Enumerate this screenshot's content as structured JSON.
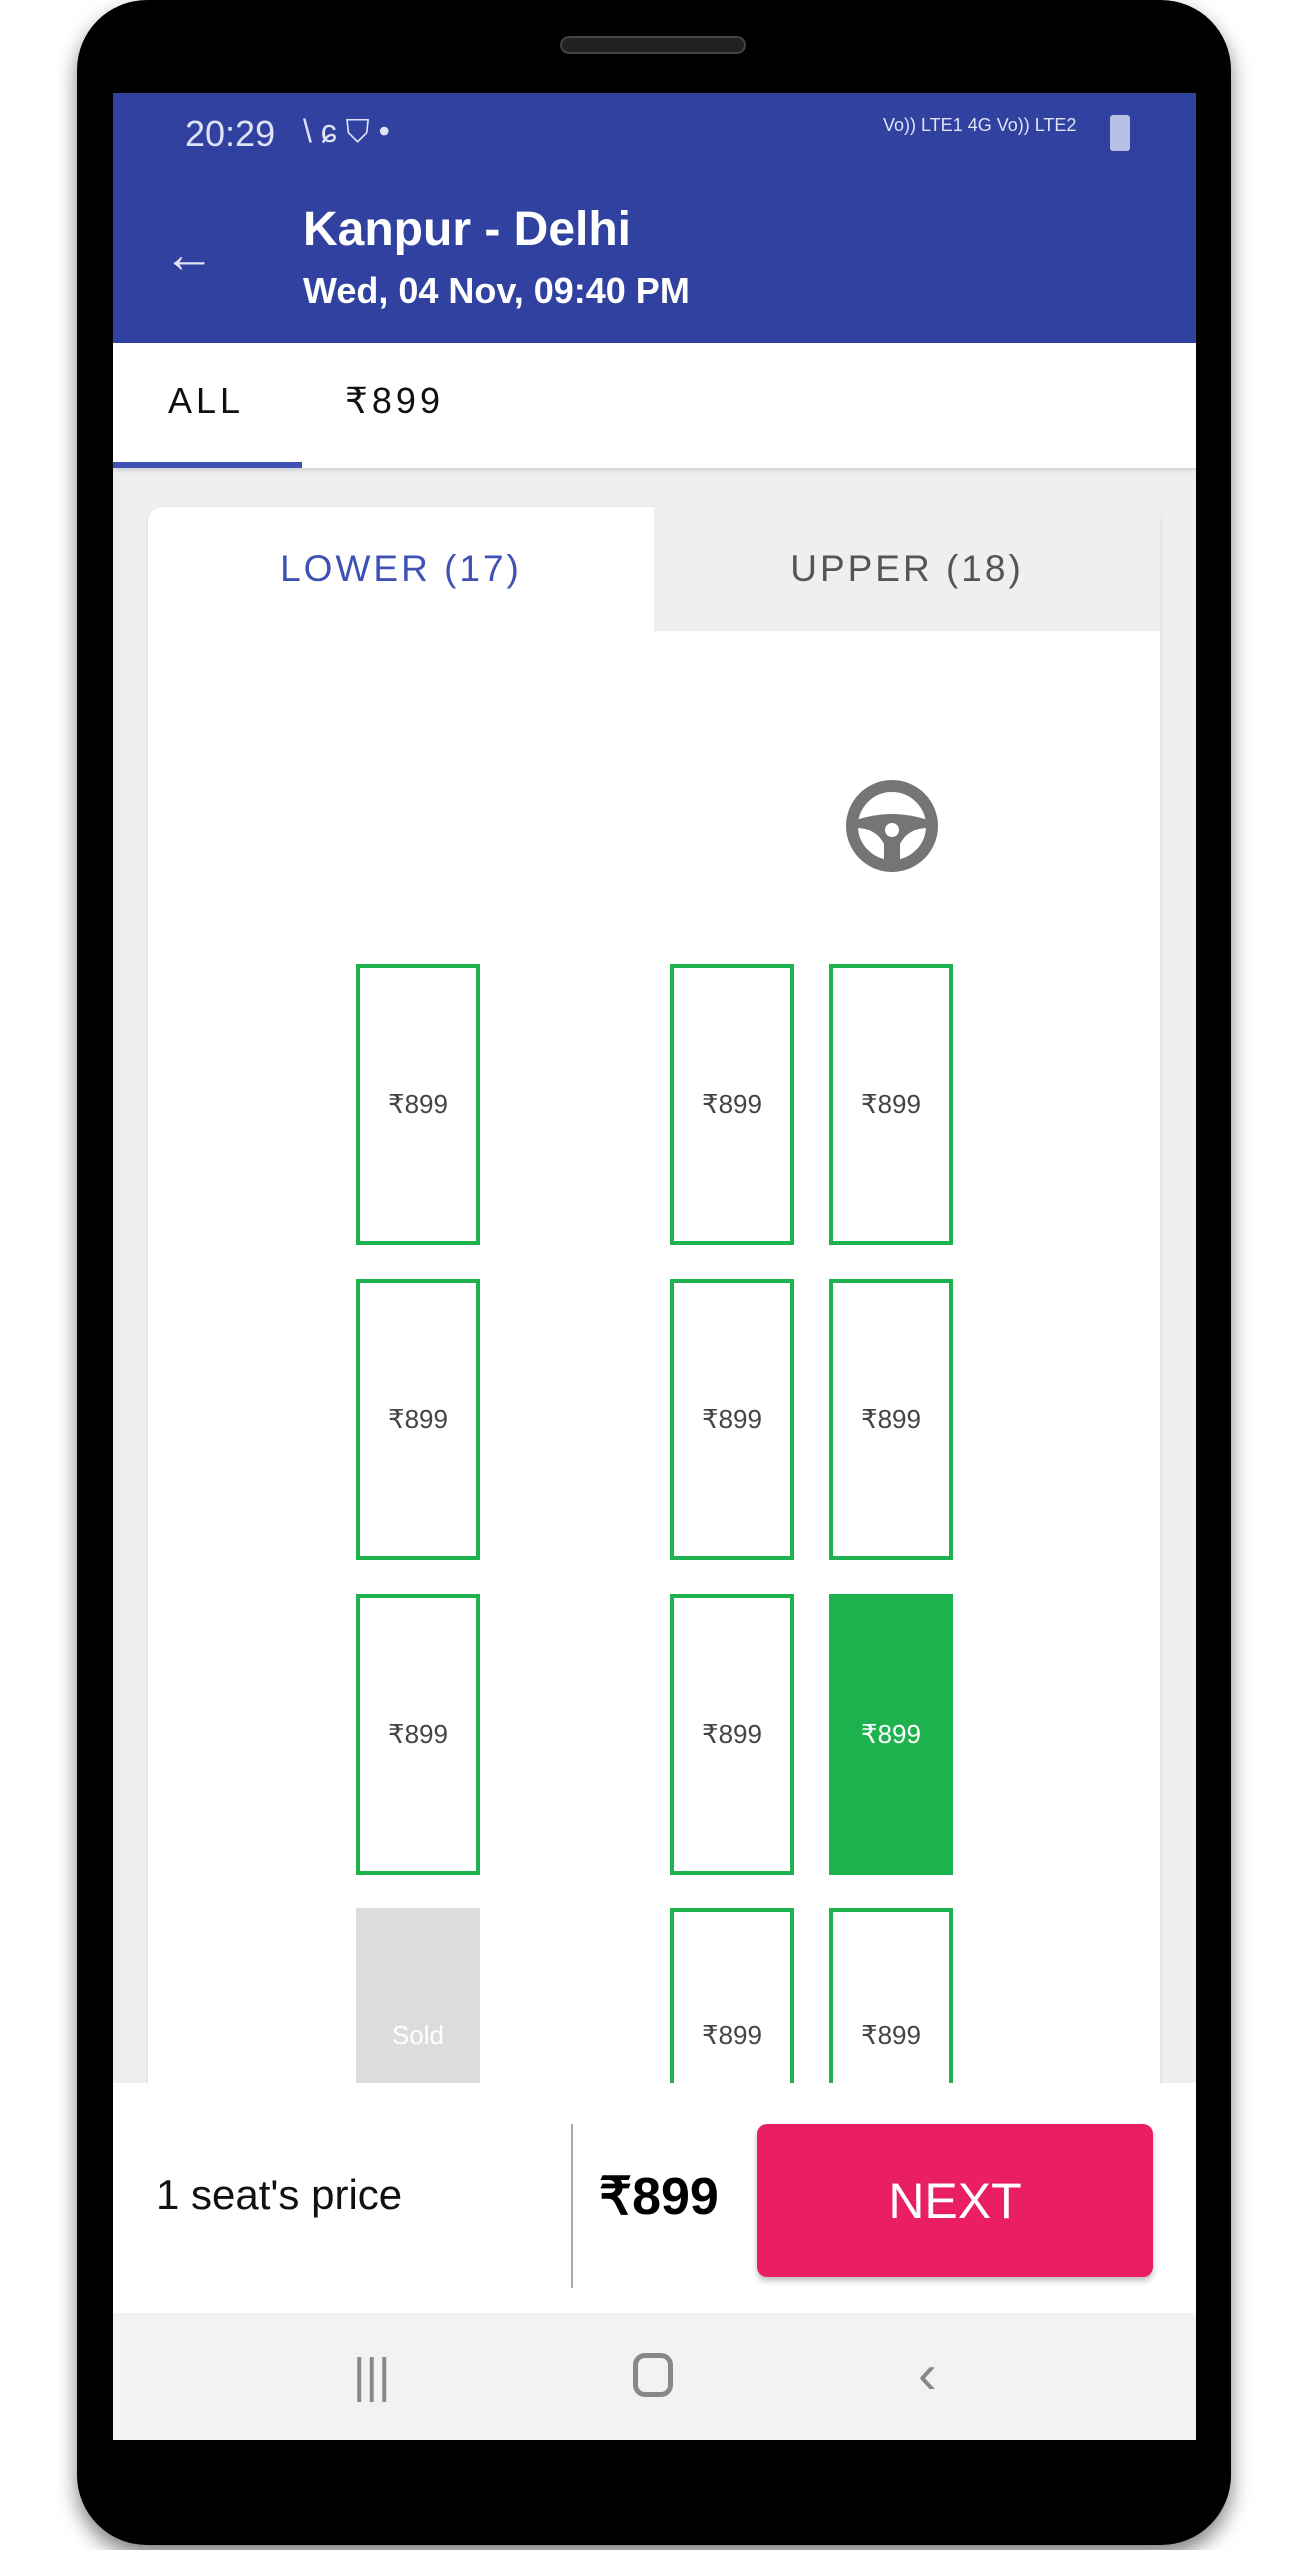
{
  "status_bar": {
    "time": "20:29",
    "right_text": "Vo)) LTE1 4G  Vo)) LTE2"
  },
  "header": {
    "title": "Kanpur - Delhi",
    "subtitle": "Wed, 04 Nov,  09:40 PM"
  },
  "filter_tabs": [
    {
      "label": "ALL",
      "active": true
    },
    {
      "label": "₹899",
      "active": false
    }
  ],
  "deck_tabs": [
    {
      "label": "LOWER (17)",
      "active": true
    },
    {
      "label": "UPPER (18)",
      "active": false
    }
  ],
  "seats": [
    [
      {
        "label": "₹899",
        "state": "available"
      },
      {
        "label": "₹899",
        "state": "available"
      },
      {
        "label": "₹899",
        "state": "available"
      }
    ],
    [
      {
        "label": "₹899",
        "state": "available"
      },
      {
        "label": "₹899",
        "state": "available"
      },
      {
        "label": "₹899",
        "state": "available"
      }
    ],
    [
      {
        "label": "₹899",
        "state": "available"
      },
      {
        "label": "₹899",
        "state": "available"
      },
      {
        "label": "₹899",
        "state": "selected"
      }
    ],
    [
      {
        "label": "Sold",
        "state": "sold"
      },
      {
        "label": "₹899",
        "state": "available"
      },
      {
        "label": "₹899",
        "state": "available"
      }
    ]
  ],
  "footer": {
    "label": "1 seat's price",
    "price": "₹899",
    "next_label": "NEXT"
  },
  "colors": {
    "primary": "#3141a0",
    "accent": "#e91e63",
    "seat_available": "#1db24e"
  }
}
